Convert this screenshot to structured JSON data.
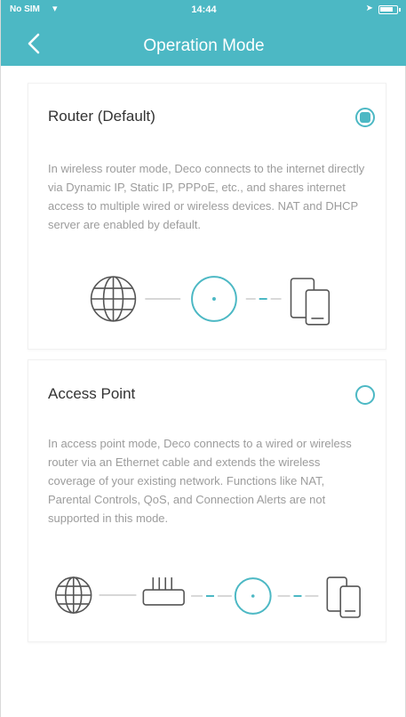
{
  "status_bar": {
    "carrier": "No SIM",
    "time": "14:44"
  },
  "header": {
    "title": "Operation Mode",
    "back_icon": "chevron-left-icon"
  },
  "options": [
    {
      "title": "Router (Default)",
      "selected": true,
      "description": "In wireless router mode, Deco connects to the internet directly via Dynamic IP, Static IP, PPPoE, etc., and shares internet access to multiple wired or wireless devices. NAT and DHCP server are enabled by default.",
      "diagram_icons": [
        "globe-icon",
        "deco-icon",
        "devices-icon"
      ]
    },
    {
      "title": "Access Point",
      "selected": false,
      "description": "In access point mode, Deco connects to a wired or wireless router via an Ethernet cable and extends the wireless coverage of your existing network. Functions like NAT, Parental Controls, QoS, and Connection Alerts are not supported in this mode.",
      "diagram_icons": [
        "globe-icon",
        "router-icon",
        "deco-icon",
        "devices-icon"
      ]
    }
  ],
  "colors": {
    "accent": "#4cb8c4",
    "description_text": "#9c9c9c",
    "title_text": "#333333"
  }
}
